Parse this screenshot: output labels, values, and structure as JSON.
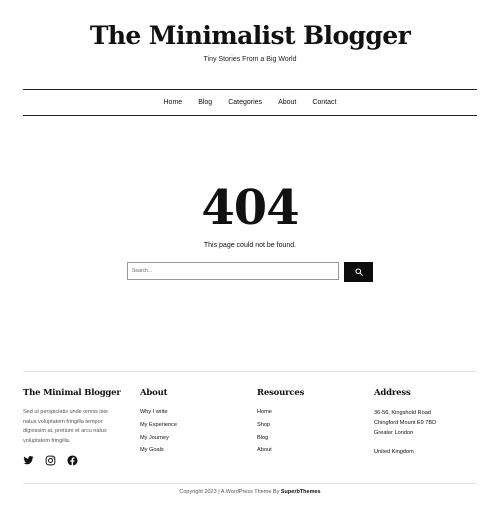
{
  "header": {
    "site_title": "The Minimalist Blogger",
    "tagline": "Tiny Stories From a Big World"
  },
  "nav": {
    "items": [
      {
        "label": "Home"
      },
      {
        "label": "Blog"
      },
      {
        "label": "Categories"
      },
      {
        "label": "About"
      },
      {
        "label": "Contact"
      }
    ]
  },
  "main": {
    "error_code": "404",
    "message": "This page could not be found.",
    "search": {
      "placeholder": "Search...",
      "value": "",
      "button_icon": "search-icon"
    }
  },
  "footer": {
    "about": {
      "title": "The Minimal Blogger",
      "text": "Sed ut perspiciatis unde omnis iste natus voluptatem fringilla tempor dignissim at, pretium et arcu natus voluptatem fringilla.",
      "social": [
        {
          "icon": "twitter-icon"
        },
        {
          "icon": "instagram-icon"
        },
        {
          "icon": "facebook-icon"
        }
      ]
    },
    "about_links": {
      "title": "About",
      "items": [
        {
          "label": "Why I write"
        },
        {
          "label": "My Experience"
        },
        {
          "label": "My Journey"
        },
        {
          "label": "My Goals"
        }
      ]
    },
    "resources": {
      "title": "Resources",
      "items": [
        {
          "label": "Home"
        },
        {
          "label": "Shop"
        },
        {
          "label": "Blog"
        },
        {
          "label": "About"
        }
      ]
    },
    "address": {
      "title": "Address",
      "line1": "36-56, Kingshold Road",
      "line2": "Chingford Mount E9 7BD",
      "line3": "Greater London",
      "country": "United Kingdom"
    },
    "copyright_prefix": "Copyright 2023 | A WordPress Theme By ",
    "copyright_brand": "SuperbThemes"
  }
}
